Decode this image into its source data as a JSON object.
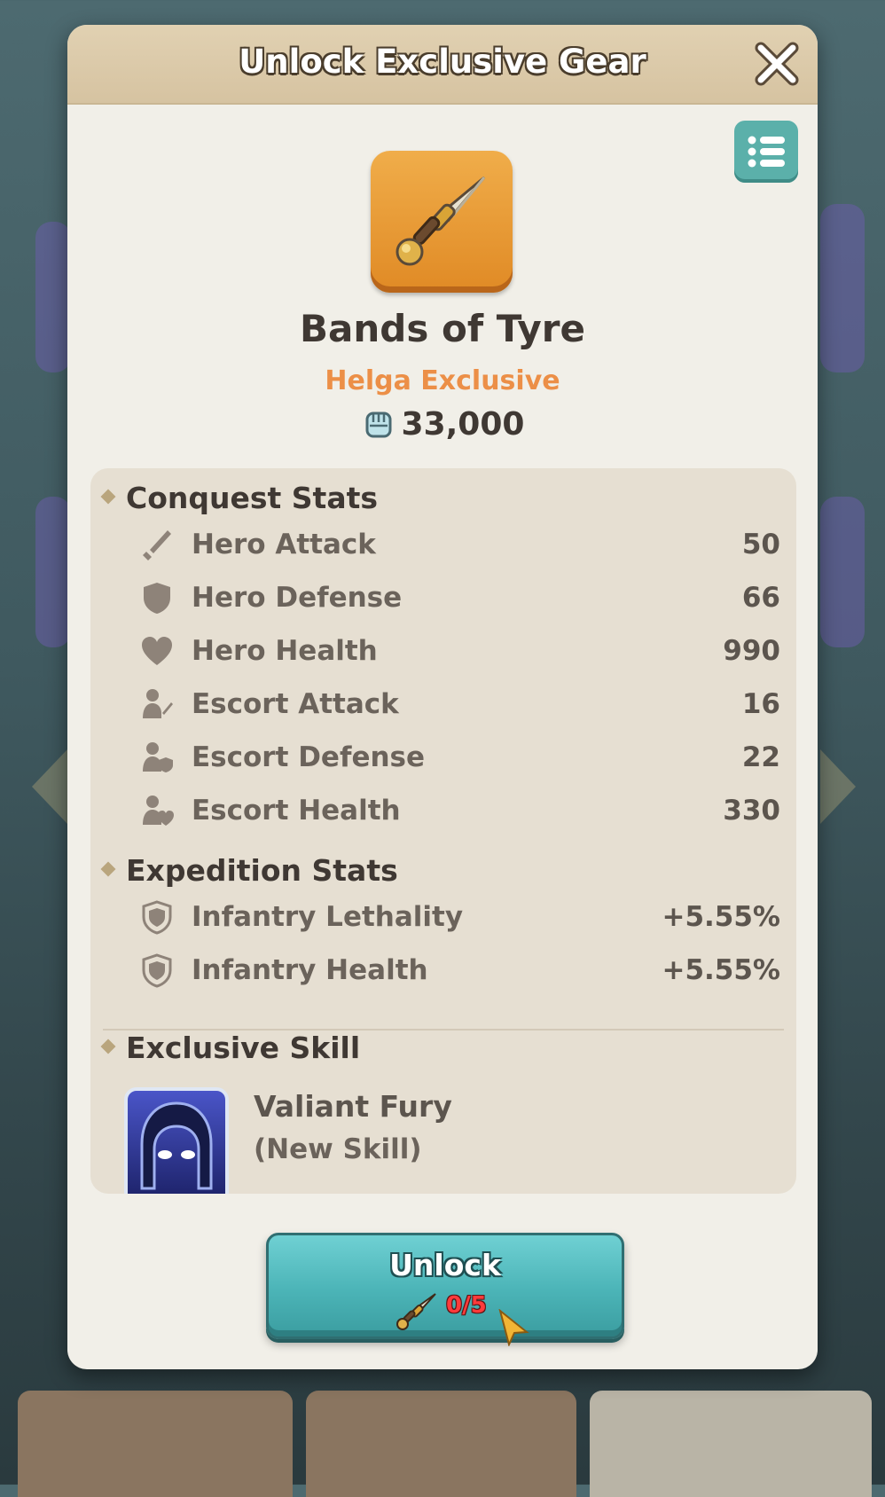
{
  "dialog": {
    "title": "Unlock Exclusive Gear"
  },
  "gear": {
    "name": "Bands of Tyre",
    "owner": "Helga Exclusive",
    "power": "33,000"
  },
  "conquest": {
    "title": "Conquest Stats",
    "stats": [
      {
        "label": "Hero Attack",
        "value": "50",
        "icon": "sword-icon"
      },
      {
        "label": "Hero Defense",
        "value": "66",
        "icon": "shield-icon"
      },
      {
        "label": "Hero Health",
        "value": "990",
        "icon": "heart-icon"
      },
      {
        "label": "Escort Attack",
        "value": "16",
        "icon": "escort-attack-icon"
      },
      {
        "label": "Escort Defense",
        "value": "22",
        "icon": "escort-defense-icon"
      },
      {
        "label": "Escort Health",
        "value": "330",
        "icon": "escort-health-icon"
      }
    ]
  },
  "expedition": {
    "title": "Expedition Stats",
    "stats": [
      {
        "label": "Infantry Lethality",
        "value": "+5.55%",
        "icon": "infantry-shield-icon"
      },
      {
        "label": "Infantry Health",
        "value": "+5.55%",
        "icon": "infantry-shield-icon"
      }
    ]
  },
  "skill": {
    "title": "Exclusive Skill",
    "name": "Valiant Fury",
    "subtitle": "(New Skill)"
  },
  "unlock": {
    "label": "Unlock",
    "cost": "0/5"
  },
  "colors": {
    "accent": "#ec8f47",
    "button": "#4bb4b7",
    "insufficient": "#ff3b3b"
  }
}
